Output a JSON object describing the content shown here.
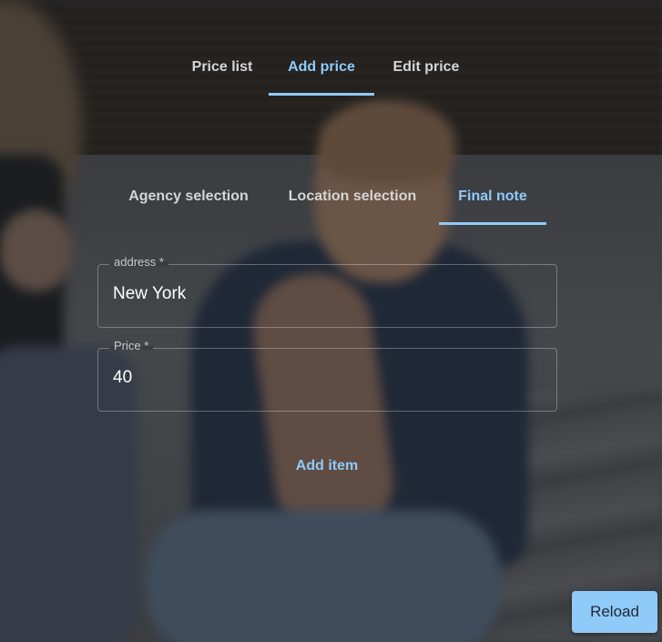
{
  "main_tabs": [
    {
      "label": "Price list",
      "active": false
    },
    {
      "label": "Add price",
      "active": true
    },
    {
      "label": "Edit price",
      "active": false
    }
  ],
  "sub_tabs": [
    {
      "label": "Agency selection",
      "active": false
    },
    {
      "label": "Location selection",
      "active": false
    },
    {
      "label": "Final note",
      "active": true
    }
  ],
  "form": {
    "address": {
      "label": "address *",
      "value": "New York"
    },
    "price": {
      "label": "Price *",
      "value": "40"
    }
  },
  "actions": {
    "add_item_label": "Add item",
    "reload_label": "Reload"
  },
  "colors": {
    "accent": "#90caf9",
    "text": "#d4d5d7"
  }
}
